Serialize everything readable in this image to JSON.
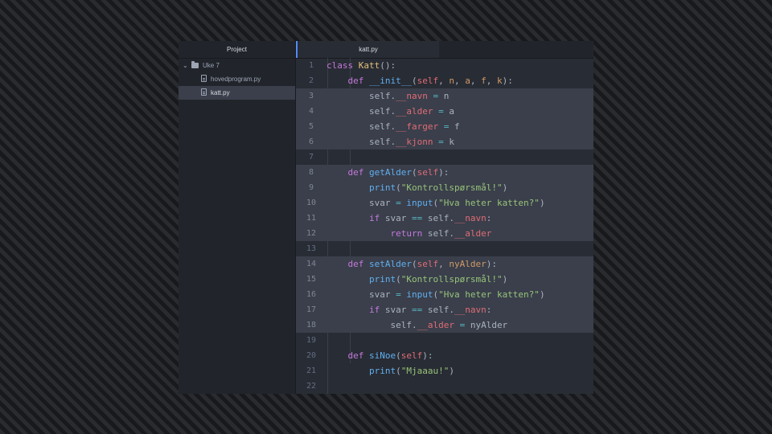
{
  "sidebar": {
    "title": "Project",
    "tree": {
      "folder": {
        "chevron": "⌄",
        "label": "Uke 7"
      },
      "files": [
        {
          "label": "hovedprogram.py",
          "selected": false
        },
        {
          "label": "katt.py",
          "selected": true
        }
      ]
    }
  },
  "editor": {
    "active_tab": "katt.py",
    "highlighted_lines": [
      3,
      4,
      5,
      6,
      8,
      9,
      10,
      11,
      12,
      14,
      15,
      16,
      17,
      18
    ],
    "lines": [
      {
        "n": "1",
        "tokens": [
          [
            "kw",
            "class "
          ],
          [
            "cls",
            "Katt"
          ],
          [
            "tx",
            "():"
          ]
        ]
      },
      {
        "n": "2",
        "tokens": [
          [
            "tx",
            "    "
          ],
          [
            "kw",
            "def "
          ],
          [
            "fn",
            "__init__"
          ],
          [
            "tx",
            "("
          ],
          [
            "sf",
            "self"
          ],
          [
            "tx",
            ", "
          ],
          [
            "pr",
            "n"
          ],
          [
            "tx",
            ", "
          ],
          [
            "pr",
            "a"
          ],
          [
            "tx",
            ", "
          ],
          [
            "pr",
            "f"
          ],
          [
            "tx",
            ", "
          ],
          [
            "pr",
            "k"
          ],
          [
            "tx",
            "):"
          ]
        ]
      },
      {
        "n": "3",
        "tokens": [
          [
            "tx",
            "        self."
          ],
          [
            "sf",
            "__navn"
          ],
          [
            "tx",
            " "
          ],
          [
            "op",
            "="
          ],
          [
            "tx",
            " n"
          ]
        ]
      },
      {
        "n": "4",
        "tokens": [
          [
            "tx",
            "        self."
          ],
          [
            "sf",
            "__alder"
          ],
          [
            "tx",
            " "
          ],
          [
            "op",
            "="
          ],
          [
            "tx",
            " a"
          ]
        ]
      },
      {
        "n": "5",
        "tokens": [
          [
            "tx",
            "        self."
          ],
          [
            "sf",
            "__farger"
          ],
          [
            "tx",
            " "
          ],
          [
            "op",
            "="
          ],
          [
            "tx",
            " f"
          ]
        ]
      },
      {
        "n": "6",
        "tokens": [
          [
            "tx",
            "        self."
          ],
          [
            "sf",
            "__kjonn"
          ],
          [
            "tx",
            " "
          ],
          [
            "op",
            "="
          ],
          [
            "tx",
            " k"
          ]
        ]
      },
      {
        "n": "7",
        "tokens": []
      },
      {
        "n": "8",
        "tokens": [
          [
            "tx",
            "    "
          ],
          [
            "kw",
            "def "
          ],
          [
            "fn",
            "getAlder"
          ],
          [
            "tx",
            "("
          ],
          [
            "sf",
            "self"
          ],
          [
            "tx",
            "):"
          ]
        ]
      },
      {
        "n": "9",
        "tokens": [
          [
            "tx",
            "        "
          ],
          [
            "fn",
            "print"
          ],
          [
            "tx",
            "("
          ],
          [
            "st",
            "\"Kontrollspørsmål!\""
          ],
          [
            "tx",
            ")"
          ]
        ]
      },
      {
        "n": "10",
        "tokens": [
          [
            "tx",
            "        svar "
          ],
          [
            "op",
            "="
          ],
          [
            "tx",
            " "
          ],
          [
            "fn",
            "input"
          ],
          [
            "tx",
            "("
          ],
          [
            "st",
            "\"Hva heter katten?\""
          ],
          [
            "tx",
            ")"
          ]
        ]
      },
      {
        "n": "11",
        "tokens": [
          [
            "tx",
            "        "
          ],
          [
            "kw",
            "if"
          ],
          [
            "tx",
            " svar "
          ],
          [
            "op",
            "=="
          ],
          [
            "tx",
            " self."
          ],
          [
            "sf",
            "__navn"
          ],
          [
            "tx",
            ":"
          ]
        ]
      },
      {
        "n": "12",
        "tokens": [
          [
            "tx",
            "            "
          ],
          [
            "kw",
            "return"
          ],
          [
            "tx",
            " self."
          ],
          [
            "sf",
            "__alder"
          ]
        ]
      },
      {
        "n": "13",
        "tokens": []
      },
      {
        "n": "14",
        "tokens": [
          [
            "tx",
            "    "
          ],
          [
            "kw",
            "def "
          ],
          [
            "fn",
            "setAlder"
          ],
          [
            "tx",
            "("
          ],
          [
            "sf",
            "self"
          ],
          [
            "tx",
            ", "
          ],
          [
            "pr",
            "nyAlder"
          ],
          [
            "tx",
            "):"
          ]
        ]
      },
      {
        "n": "15",
        "tokens": [
          [
            "tx",
            "        "
          ],
          [
            "fn",
            "print"
          ],
          [
            "tx",
            "("
          ],
          [
            "st",
            "\"Kontrollspørsmål!\""
          ],
          [
            "tx",
            ")"
          ]
        ]
      },
      {
        "n": "16",
        "tokens": [
          [
            "tx",
            "        svar "
          ],
          [
            "op",
            "="
          ],
          [
            "tx",
            " "
          ],
          [
            "fn",
            "input"
          ],
          [
            "tx",
            "("
          ],
          [
            "st",
            "\"Hva heter katten?\""
          ],
          [
            "tx",
            ")"
          ]
        ]
      },
      {
        "n": "17",
        "tokens": [
          [
            "tx",
            "        "
          ],
          [
            "kw",
            "if"
          ],
          [
            "tx",
            " svar "
          ],
          [
            "op",
            "=="
          ],
          [
            "tx",
            " self."
          ],
          [
            "sf",
            "__navn"
          ],
          [
            "tx",
            ":"
          ]
        ]
      },
      {
        "n": "18",
        "tokens": [
          [
            "tx",
            "            self."
          ],
          [
            "sf",
            "__alder"
          ],
          [
            "tx",
            " "
          ],
          [
            "op",
            "="
          ],
          [
            "tx",
            " nyAlder"
          ]
        ]
      },
      {
        "n": "19",
        "tokens": []
      },
      {
        "n": "20",
        "tokens": [
          [
            "tx",
            "    "
          ],
          [
            "kw",
            "def "
          ],
          [
            "fn",
            "siNoe"
          ],
          [
            "tx",
            "("
          ],
          [
            "sf",
            "self"
          ],
          [
            "tx",
            "):"
          ]
        ]
      },
      {
        "n": "21",
        "tokens": [
          [
            "tx",
            "        "
          ],
          [
            "fn",
            "print"
          ],
          [
            "tx",
            "("
          ],
          [
            "st",
            "\"Mjaaau!\""
          ],
          [
            "tx",
            ")"
          ]
        ]
      },
      {
        "n": "22",
        "tokens": []
      }
    ]
  },
  "colors": {
    "keyword": "#c678dd",
    "class_name": "#e5c07b",
    "function": "#61afef",
    "self_attr": "#e06c75",
    "param": "#d19a66",
    "string": "#98c379",
    "operator": "#56b6c2",
    "text": "#abb2bf"
  }
}
